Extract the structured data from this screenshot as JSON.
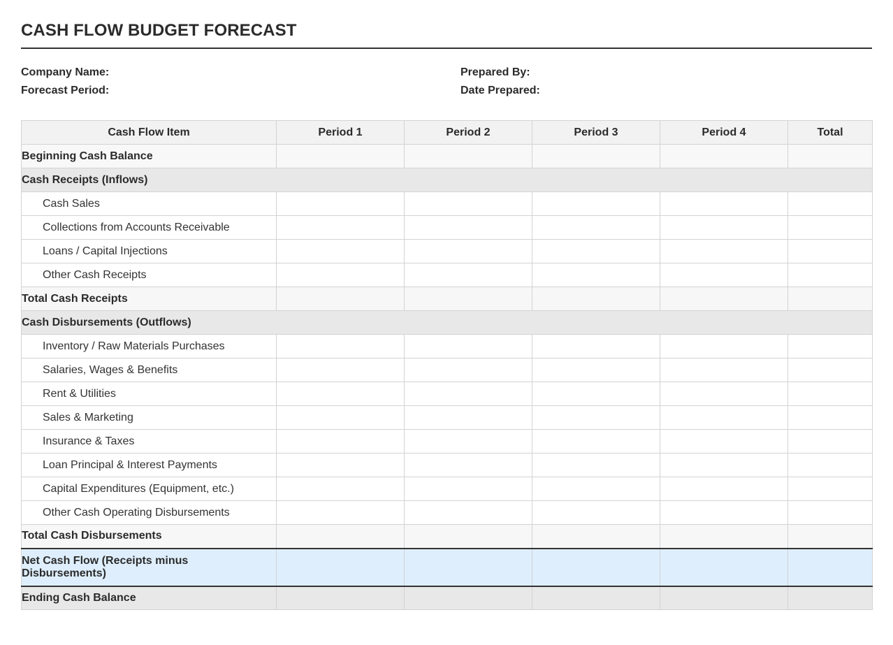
{
  "document": {
    "title": "CASH FLOW BUDGET FORECAST"
  },
  "meta": {
    "company_name_label": "Company Name:",
    "forecast_period_label": "Forecast Period:",
    "prepared_by_label": "Prepared By:",
    "date_prepared_label": "Date Prepared:"
  },
  "table": {
    "headers": [
      "Cash Flow Item",
      "Period 1",
      "Period 2",
      "Period 3",
      "Period 4",
      "Total"
    ],
    "rows": [
      {
        "label": "Beginning Cash Balance"
      },
      {
        "label": "Cash Receipts (Inflows)"
      },
      {
        "label": "Cash Sales"
      },
      {
        "label": "Collections from Accounts Receivable"
      },
      {
        "label": "Loans / Capital Injections"
      },
      {
        "label": "Other Cash Receipts"
      },
      {
        "label": "Total Cash Receipts"
      },
      {
        "label": "Cash Disbursements (Outflows)"
      },
      {
        "label": "Inventory / Raw Materials Purchases"
      },
      {
        "label": "Salaries, Wages & Benefits"
      },
      {
        "label": "Rent & Utilities"
      },
      {
        "label": "Sales & Marketing"
      },
      {
        "label": "Insurance & Taxes"
      },
      {
        "label": "Loan Principal & Interest Payments"
      },
      {
        "label": "Capital Expenditures (Equipment, etc.)"
      },
      {
        "label": "Other Cash Operating Disbursements"
      },
      {
        "label": "Total Cash Disbursements"
      },
      {
        "label": "Net Cash Flow (Receipts minus Disbursements)"
      },
      {
        "label": "Ending Cash Balance"
      }
    ]
  }
}
